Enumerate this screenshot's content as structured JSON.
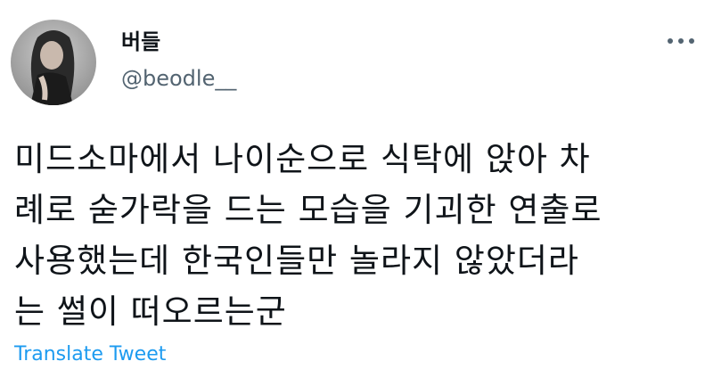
{
  "author": {
    "display_name": "버들",
    "handle": "@beodle__",
    "avatar_icon": "profile-photo"
  },
  "tweet": {
    "text_lines": [
      "미드소마에서 나이순으로 식탁에 앉아 차",
      "례로 숟가락을 드는 모습을 기괴한 연출로",
      "사용했는데 한국인들만 놀라지 않았더라",
      "는 썰이 떠오르는군"
    ],
    "translate_label": "Translate Tweet"
  },
  "menu": {
    "icon": "more-options-icon"
  },
  "colors": {
    "text": "#0f1419",
    "secondary": "#536471",
    "link": "#1d9bf0",
    "background": "#ffffff"
  }
}
